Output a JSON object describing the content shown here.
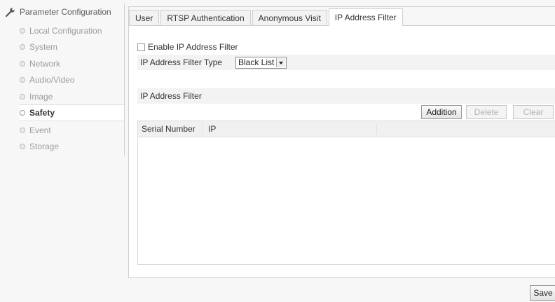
{
  "sidebar": {
    "title": "Parameter Configuration",
    "title_icon": "wrench-icon",
    "items": [
      {
        "label": "Local Configuration",
        "active": false
      },
      {
        "label": "System",
        "active": false
      },
      {
        "label": "Network",
        "active": false
      },
      {
        "label": "Audio/Video",
        "active": false
      },
      {
        "label": "Image",
        "active": false
      },
      {
        "label": "Safety",
        "active": true
      },
      {
        "label": "Event",
        "active": false
      },
      {
        "label": "Storage",
        "active": false
      }
    ]
  },
  "tabs": [
    {
      "label": "User",
      "active": false
    },
    {
      "label": "RTSP Authentication",
      "active": false
    },
    {
      "label": "Anonymous Visit",
      "active": false
    },
    {
      "label": "IP Address Filter",
      "active": true
    }
  ],
  "form": {
    "enable_label": "Enable IP Address Filter",
    "enable_checked": false,
    "filter_type_label": "IP Address Filter Type",
    "filter_type_value": "Black List",
    "section_label": "IP Address Filter"
  },
  "buttons": {
    "addition": "Addition",
    "delete": "Delete",
    "clear": "Clear",
    "save": "Save"
  },
  "table": {
    "columns": [
      "Serial Number",
      "IP"
    ],
    "rows": []
  }
}
